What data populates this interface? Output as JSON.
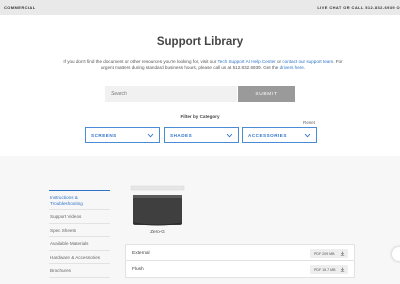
{
  "topbar": {
    "left": "COMMERCIAL",
    "right": "LIVE CHAT OR CALL 512-832-6939 O"
  },
  "page": {
    "title": "Support Library",
    "intro_1": "If you don't find the document or other resources you're looking for, visit our ",
    "intro_link_1": "Tech Support AI Help Center",
    "intro_2": " or ",
    "intro_link_2": "contact our support team",
    "intro_3": ". For urgent matters during standard business hours, please call us at 512.832.6939. Get the ",
    "intro_link_3": "drivers here",
    "intro_4": "."
  },
  "search": {
    "placeholder": "Search",
    "submit_label": "SUBMIT"
  },
  "filter": {
    "label": "Filter by Category",
    "reset": "Reset",
    "dropdowns": [
      {
        "label": "SCREENS"
      },
      {
        "label": "SHADES"
      },
      {
        "label": "ACCESSORIES"
      }
    ]
  },
  "sidebar": {
    "items": [
      {
        "label": "Instructions & Troubleshooting",
        "active": true
      },
      {
        "label": "Support Videos"
      },
      {
        "label": "Spec Sheets"
      },
      {
        "label": "Available Materials"
      },
      {
        "label": "Hardware & Accessories"
      },
      {
        "label": "Brochures"
      }
    ]
  },
  "product": {
    "name": "Zero-G"
  },
  "documents": [
    {
      "name": "External",
      "badge": "PDF 209 MB"
    },
    {
      "name": "Flush",
      "badge": "PDF 15.7 MB"
    }
  ],
  "colors": {
    "accent": "#2f74c9",
    "topbar": "#e9e9e9",
    "submit": "#9a9a9a"
  }
}
